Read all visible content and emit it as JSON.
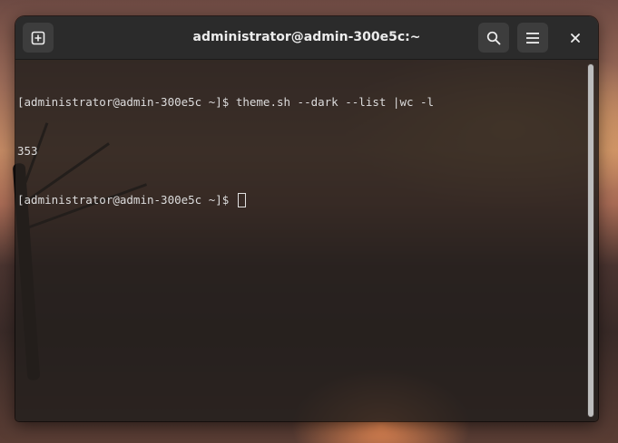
{
  "window": {
    "title": "administrator@admin-300e5c:~"
  },
  "headerbar": {
    "new_tab_icon": "new-tab-icon",
    "search_icon": "search-icon",
    "menu_icon": "hamburger-menu-icon",
    "close_label": "×"
  },
  "terminal": {
    "lines": [
      {
        "prompt": "[administrator@admin-300e5c ~]$ ",
        "command": "theme.sh --dark --list |wc -l"
      },
      {
        "output": "353"
      },
      {
        "prompt": "[administrator@admin-300e5c ~]$ ",
        "command": ""
      }
    ],
    "foreground_color": "#dcdcdc",
    "background_color": "#241f1d"
  },
  "colors": {
    "headerbar": "#2b2b2b",
    "button": "#3d3d3d",
    "scrollbar_thumb": "#bdbdbd"
  }
}
